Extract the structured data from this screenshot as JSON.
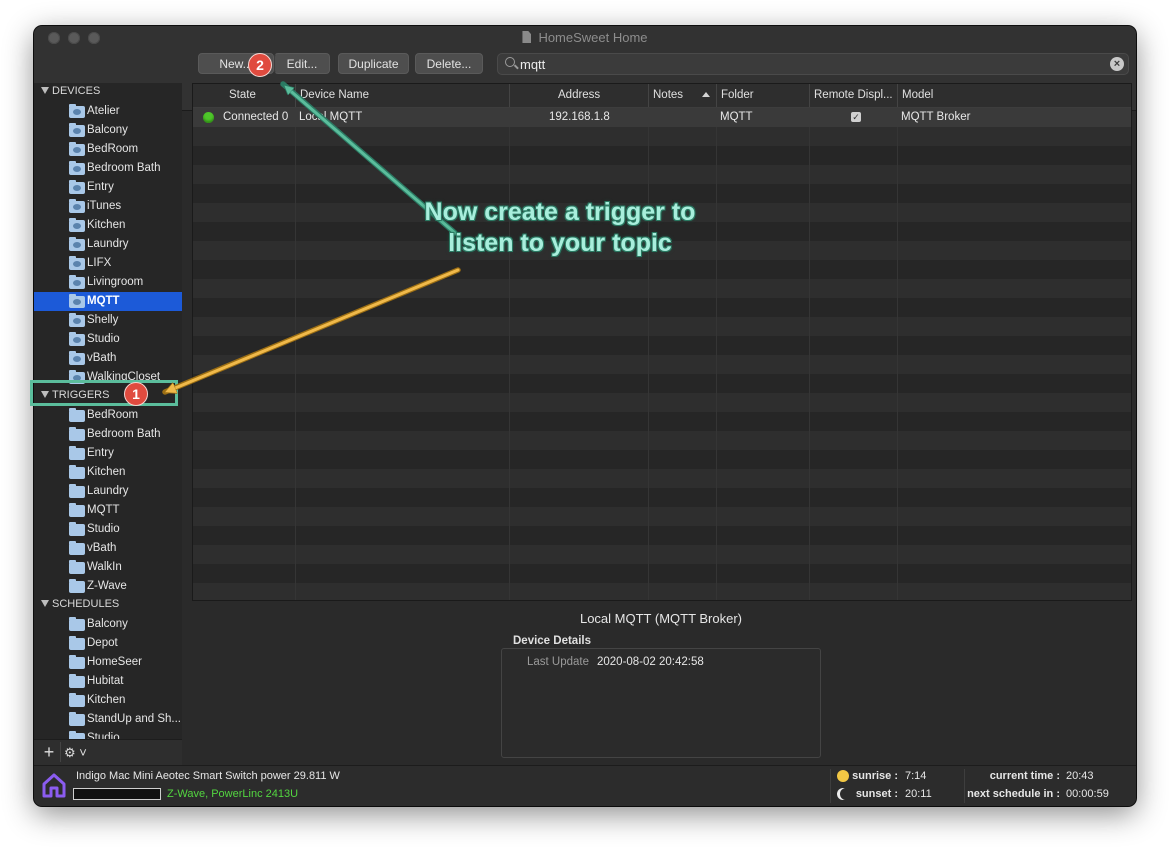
{
  "window": {
    "title": "HomeSweet Home"
  },
  "toolbar": {
    "new_label": "New...",
    "edit_label": "Edit...",
    "duplicate_label": "Duplicate",
    "delete_label": "Delete..."
  },
  "search": {
    "value": "mqtt"
  },
  "sidebar": {
    "devices_header": "DEVICES",
    "devices": [
      "Atelier",
      "Balcony",
      "BedRoom",
      "Bedroom Bath",
      "Entry",
      "iTunes",
      "Kitchen",
      "Laundry",
      "LIFX",
      "Livingroom",
      "MQTT",
      "Shelly",
      "Studio",
      "vBath",
      "WalkingCloset"
    ],
    "selected_device": "MQTT",
    "triggers_header": "TRIGGERS",
    "triggers": [
      "BedRoom",
      "Bedroom Bath",
      "Entry",
      "Kitchen",
      "Laundry",
      "MQTT",
      "Studio",
      "vBath",
      "WalkIn",
      "Z-Wave"
    ],
    "schedules_header": "SCHEDULES",
    "schedules": [
      "Balcony",
      "Depot",
      "HomeSeer",
      "Hubitat",
      "Kitchen",
      "StandUp and Sh...",
      "Studio"
    ]
  },
  "table": {
    "columns": [
      "State",
      "Device Name",
      "Address",
      "Notes",
      "Folder",
      "Remote Displ...",
      "Model"
    ],
    "rows": [
      {
        "state": "Connected 0",
        "device_name": "Local MQTT",
        "address": "192.168.1.8",
        "notes": "",
        "folder": "MQTT",
        "remote_display": true,
        "model": "MQTT Broker"
      }
    ]
  },
  "details": {
    "title": "Local MQTT (MQTT Broker)",
    "section_label": "Device Details",
    "last_update_label": "Last Update",
    "last_update_value": "2020-08-02 20:42:58"
  },
  "statusbar": {
    "message": "Indigo Mac Mini Aeotec Smart Switch power 29.811 W",
    "interfaces": "Z-Wave, PowerLinc 2413U",
    "sunrise_label": "sunrise :",
    "sunrise_value": "7:14",
    "sunset_label": "sunset :",
    "sunset_value": "20:11",
    "current_time_label": "current time :",
    "current_time_value": "20:43",
    "next_schedule_label": "next schedule in :",
    "next_schedule_value": "00:00:59"
  },
  "annotation": {
    "text_line1": "Now create a trigger to",
    "text_line2": "listen to your topic",
    "badge1": "1",
    "badge2": "2",
    "arrow_teal_color": "#5bbd9c",
    "arrow_yellow_color": "#f0b94a"
  }
}
